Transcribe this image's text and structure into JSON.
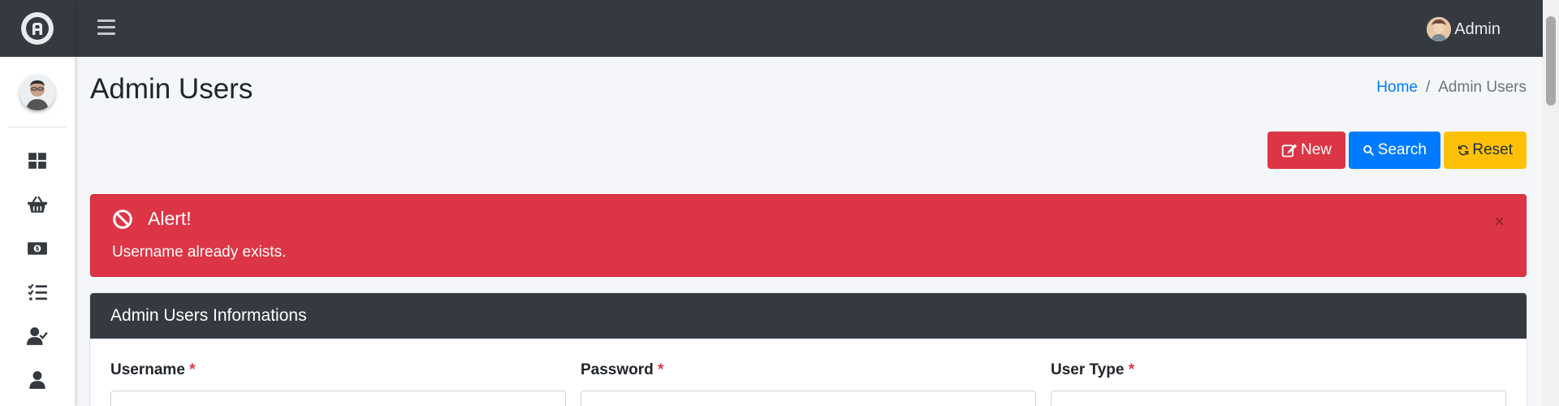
{
  "topbar": {
    "user_name": "Admin"
  },
  "sidebar": {
    "items": [
      {
        "icon": "dashboard-icon"
      },
      {
        "icon": "basket-icon"
      },
      {
        "icon": "money-bill-icon"
      },
      {
        "icon": "tasks-icon"
      },
      {
        "icon": "user-check-icon"
      },
      {
        "icon": "user-icon"
      }
    ]
  },
  "page": {
    "title": "Admin Users",
    "breadcrumb": {
      "home": "Home",
      "separator": "/",
      "current": "Admin Users"
    }
  },
  "actions": {
    "new_label": "New",
    "search_label": "Search",
    "reset_label": "Reset"
  },
  "alert": {
    "title": "Alert!",
    "message": "Username already exists.",
    "close": "×"
  },
  "card": {
    "title": "Admin Users Informations",
    "fields": [
      {
        "label": "Username",
        "required_mark": "*"
      },
      {
        "label": "Password",
        "required_mark": "*"
      },
      {
        "label": "User Type",
        "required_mark": "*"
      }
    ]
  },
  "colors": {
    "dark": "#343a40",
    "danger": "#dc3545",
    "primary": "#007bff",
    "warning": "#ffc107",
    "background": "#f4f6f9"
  }
}
